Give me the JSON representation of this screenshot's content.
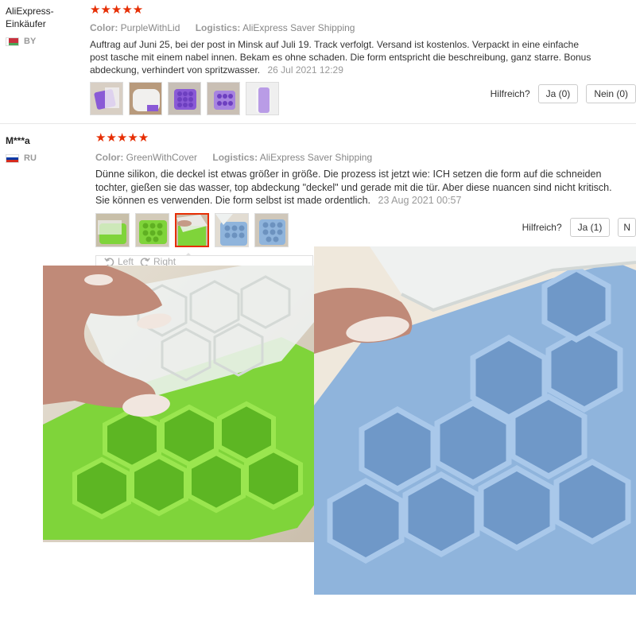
{
  "reviews": [
    {
      "user": "AliExpress-Einkäufer",
      "country": "BY",
      "stars": "★★★★★",
      "color_label": "Color:",
      "color_value": "PurpleWithLid",
      "logistics_label": "Logistics:",
      "logistics_value": "AliExpress Saver Shipping",
      "text": "Auftrag auf Juni 25, bei der post in Minsk auf Juli 19. Track verfolgt. Versand ist kostenlos. Verpackt in eine einfache post tasche mit einem nabel innen. Bekam es ohne schaden. Die form entspricht die beschreibung, ganz starre. Bonus abdeckung, verhindert von spritzwasser.",
      "date": "26 Jul 2021 12:29",
      "helpful_label": "Hilfreich?",
      "yes_label": "Ja (0)",
      "no_label": "Nein (0)"
    },
    {
      "user": "M***a",
      "country": "RU",
      "stars": "★★★★★",
      "color_label": "Color:",
      "color_value": "GreenWithCover",
      "logistics_label": "Logistics:",
      "logistics_value": "AliExpress Saver Shipping",
      "text": "Dünne silikon, die deckel ist etwas größer in größe. Die prozess ist jetzt wie: ICH setzen die form auf die schneiden tochter, gießen sie das wasser, top abdeckung \"deckel\" und gerade mit die tür. Aber diese nuancen sind nicht kritisch. Sie können es verwenden. Die form selbst ist made ordentlich.",
      "date": "23 Aug 2021 00:57",
      "helpful_label": "Hilfreich?",
      "yes_label": "Ja (1)",
      "no_label": "N"
    }
  ],
  "gallery_nav": {
    "left": "Left",
    "right": "Right"
  },
  "colors": {
    "star": "#e62e04",
    "green_tray": "#7fd43a",
    "blue_tray": "#8fb4dc",
    "purple_tray": "#8a5ad6",
    "lid": "#eef1f0"
  },
  "icons": {
    "rotate_left": "rotate-left-icon",
    "rotate_right": "rotate-right-icon"
  }
}
